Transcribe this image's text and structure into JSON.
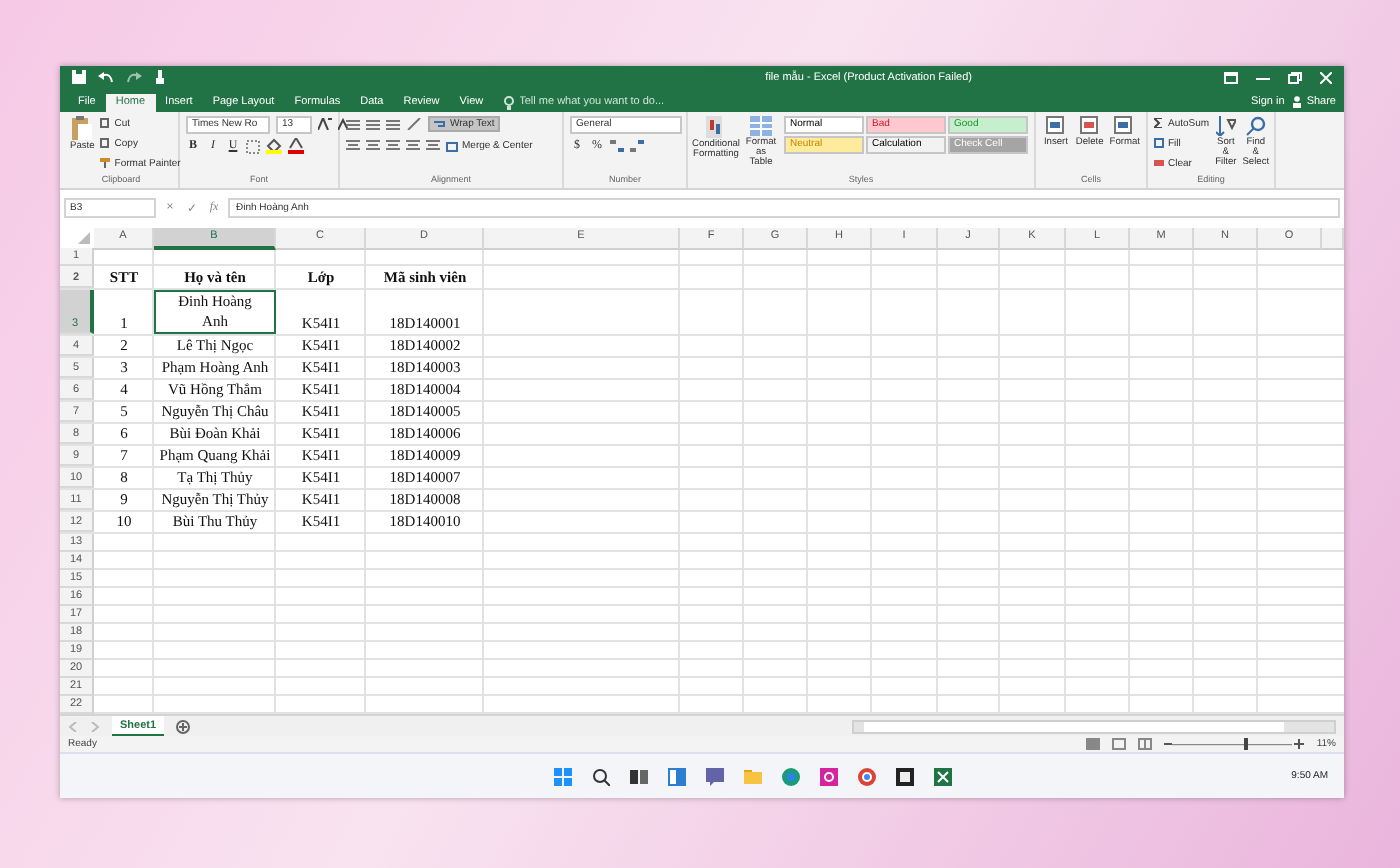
{
  "window": {
    "title": "file mẫu - Excel (Product Activation Failed)",
    "sign_in": "Sign in",
    "share": "Share"
  },
  "tabs": [
    {
      "label": "File",
      "selected": false
    },
    {
      "label": "Home",
      "selected": true
    },
    {
      "label": "Insert",
      "selected": false
    },
    {
      "label": "Page Layout",
      "selected": false
    },
    {
      "label": "Formulas",
      "selected": false
    },
    {
      "label": "Data",
      "selected": false
    },
    {
      "label": "Review",
      "selected": false
    },
    {
      "label": "View",
      "selected": false
    }
  ],
  "tell_me": {
    "placeholder": "Tell me what you want to do..."
  },
  "ribbon": {
    "clipboard": {
      "label": "Clipboard",
      "paste": "Paste",
      "cut": "Cut",
      "copy": "Copy",
      "format_painter": "Format Painter"
    },
    "font": {
      "label": "Font",
      "name": "Times New Ro",
      "size": "13",
      "bold": "B",
      "italic": "I",
      "underline": "U"
    },
    "alignment": {
      "label": "Alignment",
      "wrap_text": {
        "label": "Wrap Text",
        "on": true
      },
      "merge": "Merge & Center"
    },
    "number": {
      "label": "Number",
      "format": "General",
      "currency": "$",
      "percent": "%"
    },
    "styles": {
      "label": "Styles",
      "conditional": "Conditional Formatting",
      "format_table": "Format as Table",
      "cell_styles": [
        {
          "label": "Normal",
          "color": "#ffffff"
        },
        {
          "label": "Bad",
          "color": "#ffc7ce"
        },
        {
          "label": "Good",
          "color": "#c6efce"
        },
        {
          "label": "Neutral",
          "color": "#ffeb9c"
        },
        {
          "label": "Calculation",
          "color": "#f2f2f2"
        },
        {
          "label": "Check Cell",
          "color": "#a5a5a5"
        }
      ]
    },
    "cells": {
      "label": "Cells",
      "buttons": [
        "Insert",
        "Delete",
        "Format"
      ]
    },
    "editing": {
      "label": "Editing",
      "autosum": "AutoSum",
      "fill": "Fill",
      "clear": "Clear",
      "sort": "Sort & Filter",
      "find": "Find & Select"
    }
  },
  "formula_bar": {
    "name_box": "B3",
    "cancel": "×",
    "enter": "✓",
    "function": "fx",
    "value": "Đinh Hoàng Anh"
  },
  "columns": [
    {
      "label": "A",
      "selected": false
    },
    {
      "label": "B",
      "selected": true
    },
    {
      "label": "C",
      "selected": false
    },
    {
      "label": "D",
      "selected": false
    },
    {
      "label": "E",
      "selected": false
    },
    {
      "label": "F",
      "selected": false
    },
    {
      "label": "G",
      "selected": false
    },
    {
      "label": "H",
      "selected": false
    },
    {
      "label": "I",
      "selected": false
    },
    {
      "label": "J",
      "selected": false
    },
    {
      "label": "K",
      "selected": false
    },
    {
      "label": "L",
      "selected": false
    },
    {
      "label": "M",
      "selected": false
    },
    {
      "label": "N",
      "selected": false
    },
    {
      "label": "O",
      "selected": false
    }
  ],
  "rows": [
    {
      "header": "1",
      "kind": "empty",
      "selected": false
    },
    {
      "header": "2",
      "kind": "header",
      "selected": false,
      "cells": [
        "STT",
        "Họ và tên",
        "Lớp",
        "Mã sinh viên"
      ]
    },
    {
      "header": "3",
      "kind": "data",
      "selected": true,
      "wrapped": true,
      "cells": [
        "1",
        "Đinh Hoàng Anh",
        "K54I1",
        "18D140001"
      ]
    },
    {
      "header": "4",
      "kind": "data",
      "selected": false,
      "cells": [
        "2",
        "Lê Thị Ngọc",
        "K54I1",
        "18D140002"
      ]
    },
    {
      "header": "5",
      "kind": "data",
      "selected": false,
      "cells": [
        "3",
        "Phạm Hoàng Anh",
        "K54I1",
        "18D140003"
      ]
    },
    {
      "header": "6",
      "kind": "data",
      "selected": false,
      "cells": [
        "4",
        "Vũ Hồng Thắm",
        "K54I1",
        "18D140004"
      ]
    },
    {
      "header": "7",
      "kind": "data",
      "selected": false,
      "cells": [
        "5",
        "Nguyễn Thị Châu",
        "K54I1",
        "18D140005"
      ]
    },
    {
      "header": "8",
      "kind": "data",
      "selected": false,
      "cells": [
        "6",
        "Bùi Đoàn Khải",
        "K54I1",
        "18D140006"
      ]
    },
    {
      "header": "9",
      "kind": "data",
      "selected": false,
      "cells": [
        "7",
        "Phạm Quang Khải",
        "K54I1",
        "18D140009"
      ]
    },
    {
      "header": "10",
      "kind": "data",
      "selected": false,
      "cells": [
        "8",
        "Tạ Thị Thủy",
        "K54I1",
        "18D140007"
      ]
    },
    {
      "header": "11",
      "kind": "data",
      "selected": false,
      "cells": [
        "9",
        "Nguyễn Thị Thủy",
        "K54I1",
        "18D140008"
      ]
    },
    {
      "header": "12",
      "kind": "data",
      "selected": false,
      "cells": [
        "10",
        "Bùi Thu Thủy",
        "K54I1",
        "18D140010"
      ]
    },
    {
      "header": "13",
      "kind": "empty",
      "selected": false
    },
    {
      "header": "14",
      "kind": "empty",
      "selected": false
    },
    {
      "header": "15",
      "kind": "empty",
      "selected": false
    },
    {
      "header": "16",
      "kind": "empty",
      "selected": false
    },
    {
      "header": "17",
      "kind": "empty",
      "selected": false
    },
    {
      "header": "18",
      "kind": "empty",
      "selected": false
    },
    {
      "header": "19",
      "kind": "empty",
      "selected": false
    },
    {
      "header": "20",
      "kind": "empty",
      "selected": false
    },
    {
      "header": "21",
      "kind": "empty",
      "selected": false
    },
    {
      "header": "22",
      "kind": "empty",
      "selected": false
    }
  ],
  "sheet_tabs": [
    {
      "label": "Sheet1",
      "selected": true
    }
  ],
  "status_bar": {
    "status": "Ready",
    "zoom": "11%"
  },
  "taskbar": {
    "time": "9:50 AM"
  }
}
